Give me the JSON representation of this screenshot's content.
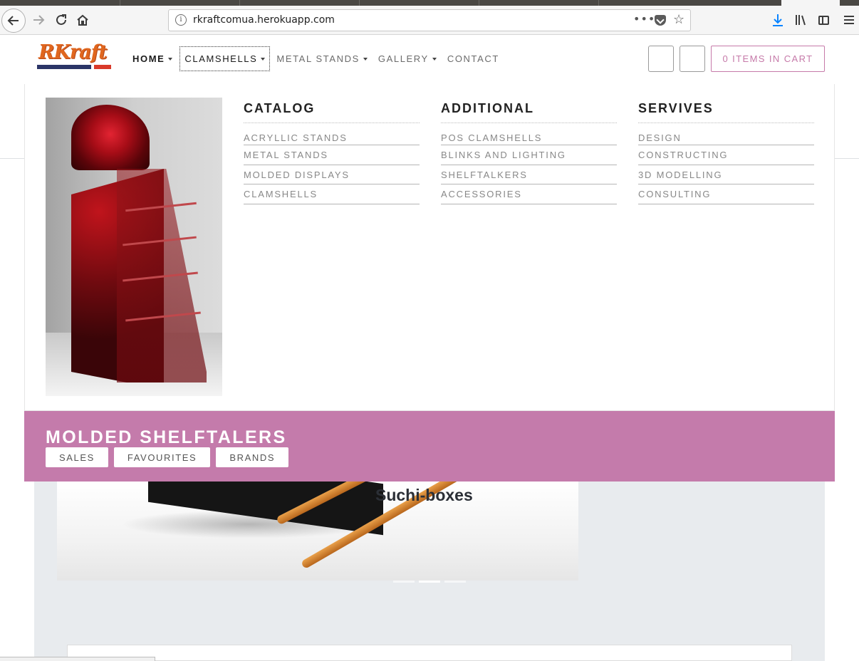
{
  "browser": {
    "url": "rkraftcomua.herokuapp.com",
    "more_glyph": "•••"
  },
  "site": {
    "logo_text": "RKraft",
    "nav": [
      {
        "label": "HOME"
      },
      {
        "label": "CLAMSHELLS"
      },
      {
        "label": "METAL STANDS"
      },
      {
        "label": "GALLERY"
      },
      {
        "label": "CONTACT"
      }
    ],
    "cart_label": "0 ITEMS IN CART",
    "accent_color": "#c47bab"
  },
  "mega_menu": {
    "columns": [
      {
        "title": "CATALOG",
        "items": [
          "ACRYLLIC STANDS",
          "METAL STANDS",
          "MOLDED DISPLAYS",
          "CLAMSHELLS"
        ]
      },
      {
        "title": "ADDITIONAL",
        "items": [
          "POS CLAMSHELLS",
          "BLINKS AND LIGHTING",
          "SHELFTALKERS",
          "ACCESSORIES"
        ]
      },
      {
        "title": "SERVIVES",
        "items": [
          "DESIGN",
          "CONSTRUCTING",
          "3D MODELLING",
          "CONSULTING"
        ]
      }
    ]
  },
  "promo": {
    "title": "MOLDED SHELFTALERS",
    "tags": [
      "SALES",
      "FAVOURITES",
      "BRANDS"
    ]
  },
  "slider": {
    "caption": "Suchi-boxes"
  }
}
